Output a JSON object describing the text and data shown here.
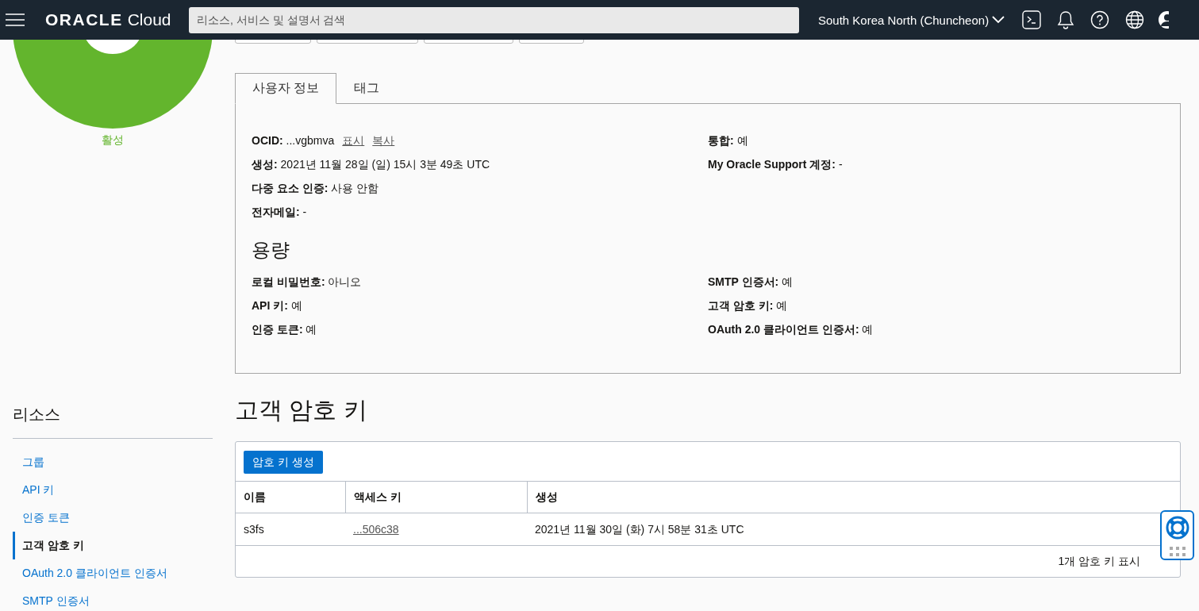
{
  "header": {
    "logo_brand": "ORACLE",
    "logo_product": "Cloud",
    "search": {
      "placeholder": "리소스, 서비스 및 설명서 검색"
    },
    "region": "South Korea North (Chuncheon)"
  },
  "user": {
    "status": "활성"
  },
  "tabs": [
    {
      "label": "사용자 정보",
      "selected": true
    },
    {
      "label": "태그",
      "selected": false
    }
  ],
  "details": {
    "left": [
      {
        "text": "**OCID:** ...vgbmva",
        "links": [
          "표시",
          "복사"
        ]
      },
      {
        "text": "**생성:** 2021년 11월 28일 (일) 15시 3분 49초 UTC"
      },
      {
        "text": "**다중 요소 인증:** 사용 안함"
      },
      {
        "text": "**전자메일:** -"
      }
    ],
    "right": [
      {
        "text": "**통합:** 예"
      },
      {
        "text": "**My Oracle Support 계정:** -"
      }
    ]
  },
  "capacity": {
    "title": "용량",
    "left": [
      {
        "text": "**로컬 비밀번호:** 아니오"
      },
      {
        "text": "**API 키:** 예"
      },
      {
        "text": "**인증 토큰:** 예"
      }
    ],
    "right": [
      {
        "text": "**SMTP 인증서:** 예"
      },
      {
        "text": "**고객 암호 키:** 예"
      },
      {
        "text": "**OAuth 2.0 클라이언트 인증서:** 예"
      }
    ]
  },
  "resources": {
    "title": "리소스",
    "items": [
      {
        "label": "그룹",
        "selected": false
      },
      {
        "label": "API 키",
        "selected": false
      },
      {
        "label": "인증 토큰",
        "selected": false
      },
      {
        "label": "고객 암호 키",
        "selected": true
      },
      {
        "label": "OAuth 2.0 클라이언트 인증서",
        "selected": false
      },
      {
        "label": "SMTP 인증서",
        "selected": false
      }
    ]
  },
  "section": {
    "title": "고객 암호 키",
    "button": "암호 키 생성",
    "table": {
      "columns": [
        "이름",
        "액세스 키",
        "생성"
      ],
      "rows": [
        [
          {
            "kind": "text",
            "text": "s3fs"
          },
          {
            "kind": "link",
            "text": "...506c38"
          },
          {
            "kind": "text",
            "text": "2021년 11월 30일 (화) 7시 58분 31초 UTC"
          }
        ]
      ]
    },
    "footer": "1개 암호 키 표시"
  }
}
